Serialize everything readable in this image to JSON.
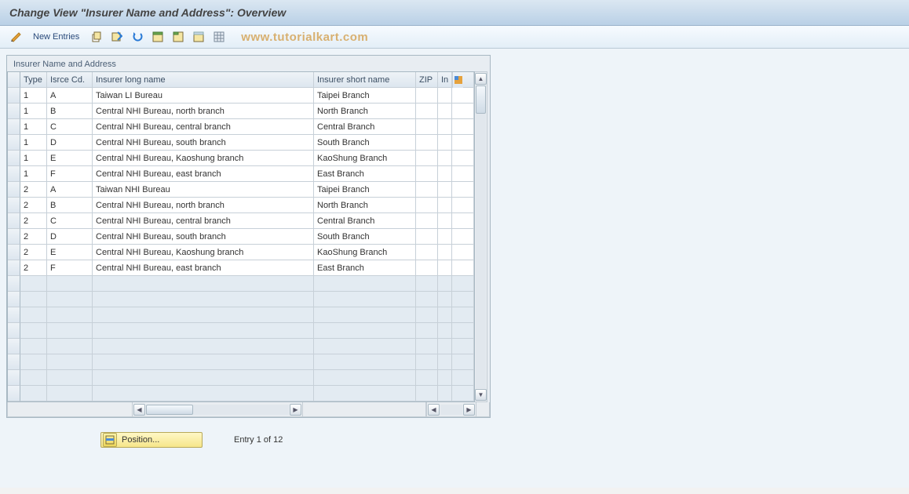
{
  "header": {
    "title": "Change View \"Insurer Name and Address\": Overview"
  },
  "toolbar": {
    "new_entries": "New Entries",
    "watermark": "www.tutorialkart.com"
  },
  "panel": {
    "title": "Insurer Name and Address"
  },
  "columns": {
    "type": "Type",
    "isrce": "Isrce Cd.",
    "long": "Insurer long name",
    "short": "Insurer short name",
    "zip": "ZIP",
    "in": "In"
  },
  "rows": [
    {
      "type": "1",
      "isrce": "A",
      "long": "Taiwan LI Bureau",
      "short": "Taipei Branch",
      "zip": "",
      "in": ""
    },
    {
      "type": "1",
      "isrce": "B",
      "long": "Central NHI Bureau, north branch",
      "short": "North Branch",
      "zip": "",
      "in": ""
    },
    {
      "type": "1",
      "isrce": "C",
      "long": "Central NHI Bureau, central branch",
      "short": "Central Branch",
      "zip": "",
      "in": ""
    },
    {
      "type": "1",
      "isrce": "D",
      "long": "Central NHI Bureau, south branch",
      "short": "South Branch",
      "zip": "",
      "in": ""
    },
    {
      "type": "1",
      "isrce": "E",
      "long": "Central NHI Bureau, Kaoshung branch",
      "short": "KaoShung Branch",
      "zip": "",
      "in": ""
    },
    {
      "type": "1",
      "isrce": "F",
      "long": "Central NHI Bureau, east branch",
      "short": "East Branch",
      "zip": "",
      "in": ""
    },
    {
      "type": "2",
      "isrce": "A",
      "long": "Taiwan NHI Bureau",
      "short": "Taipei Branch",
      "zip": "",
      "in": ""
    },
    {
      "type": "2",
      "isrce": "B",
      "long": "Central NHI Bureau, north branch",
      "short": "North Branch",
      "zip": "",
      "in": ""
    },
    {
      "type": "2",
      "isrce": "C",
      "long": "Central NHI Bureau, central branch",
      "short": "Central Branch",
      "zip": "",
      "in": ""
    },
    {
      "type": "2",
      "isrce": "D",
      "long": "Central NHI Bureau, south branch",
      "short": "South Branch",
      "zip": "",
      "in": ""
    },
    {
      "type": "2",
      "isrce": "E",
      "long": "Central NHI Bureau, Kaoshung branch",
      "short": "KaoShung Branch",
      "zip": "",
      "in": ""
    },
    {
      "type": "2",
      "isrce": "F",
      "long": "Central NHI Bureau, east branch",
      "short": "East Branch",
      "zip": "",
      "in": ""
    }
  ],
  "empty_row_count": 8,
  "footer": {
    "position_button": "Position...",
    "entry_text": "Entry 1 of 12"
  }
}
